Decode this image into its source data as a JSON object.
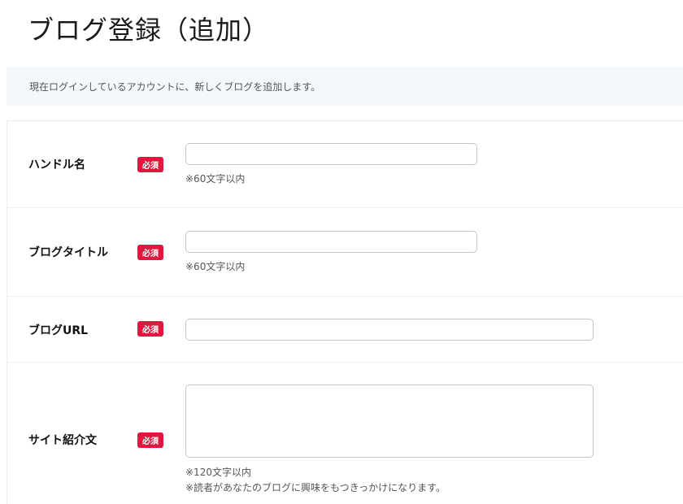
{
  "page": {
    "title": "ブログ登録（追加）",
    "info": "現在ログインしているアカウントに、新しくブログを追加します。"
  },
  "required_label": "必須",
  "colors": {
    "required_badge": "#e0173e",
    "info_background": "#f3f9fb"
  },
  "fields": {
    "handle_name": {
      "label": "ハンドル名",
      "value": "",
      "note": "※60文字以内"
    },
    "blog_title": {
      "label": "ブログタイトル",
      "value": "",
      "note": "※60文字以内"
    },
    "blog_url": {
      "label": "ブログURL",
      "value": ""
    },
    "site_intro": {
      "label": "サイト紹介文",
      "value": "",
      "note1": "※120文字以内",
      "note2": "※読者があなたのブログに興味をもつきっかけになります。"
    }
  }
}
